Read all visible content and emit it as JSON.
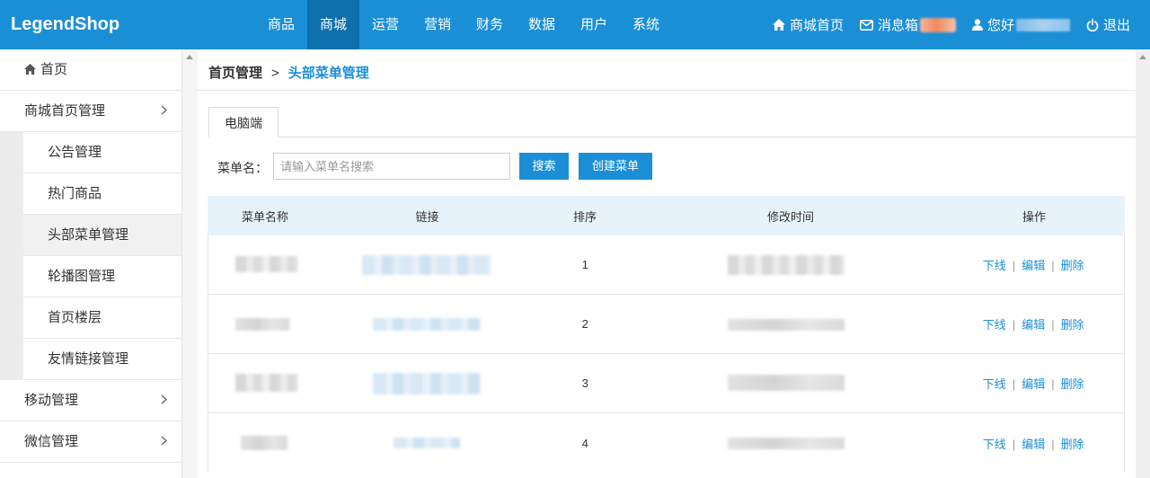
{
  "app": {
    "logo": "LegendShop"
  },
  "topnav": {
    "items": [
      {
        "label": "商品",
        "active": false
      },
      {
        "label": "商城",
        "active": true
      },
      {
        "label": "运营",
        "active": false
      },
      {
        "label": "营销",
        "active": false
      },
      {
        "label": "财务",
        "active": false
      },
      {
        "label": "数据",
        "active": false
      },
      {
        "label": "用户",
        "active": false
      },
      {
        "label": "系统",
        "active": false
      }
    ],
    "right": {
      "home": "商城首页",
      "inbox": "消息箱",
      "greeting": "您好",
      "logout": "退出"
    }
  },
  "sidebar": {
    "home": "首页",
    "groups": [
      {
        "label": "商城首页管理"
      },
      {
        "label": "移动管理"
      },
      {
        "label": "微信管理"
      }
    ],
    "sub_items": [
      {
        "label": "公告管理"
      },
      {
        "label": "热门商品"
      },
      {
        "label": "头部菜单管理",
        "active": true
      },
      {
        "label": "轮播图管理"
      },
      {
        "label": "首页楼层"
      },
      {
        "label": "友情链接管理"
      }
    ]
  },
  "main": {
    "breadcrumb": {
      "home": "首页管理",
      "separator": ">",
      "current": "头部菜单管理"
    },
    "tab": "电脑端",
    "search": {
      "label": "菜单名：",
      "placeholder": "请输入菜单名搜索",
      "search_button": "搜索",
      "create_button": "创建菜单"
    },
    "table": {
      "headers": [
        "菜单名称",
        "链接",
        "排序",
        "修改时间",
        "操作"
      ],
      "rows": [
        {
          "sort": "1"
        },
        {
          "sort": "2"
        },
        {
          "sort": "3"
        },
        {
          "sort": "4"
        }
      ],
      "actions": {
        "offline": "下线",
        "edit": "编辑",
        "delete": "删除",
        "sep": "|"
      }
    }
  },
  "colors": {
    "primary": "#1b8fd6",
    "nav_active": "#0d6fae",
    "table_header_bg": "#e6f3fb"
  }
}
